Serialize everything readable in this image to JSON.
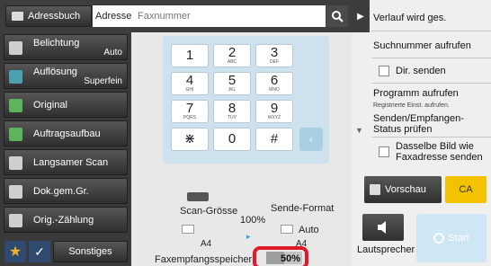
{
  "topbar": {
    "adressbuch_label": "Adressbuch",
    "adresse_label": "Adresse",
    "fax_placeholder": "Faxnummer",
    "search_icon": "search-icon"
  },
  "menu": [
    {
      "label": "Belichtung",
      "value": "Auto",
      "icon": "exposure-icon"
    },
    {
      "label": "Auflösung",
      "value": "Superfein",
      "icon": "resolution-icon"
    },
    {
      "label": "Original",
      "value": "",
      "icon": "original-icon"
    },
    {
      "label": "Auftragsaufbau",
      "value": "",
      "icon": "job-build-icon"
    },
    {
      "label": "Langsamer Scan",
      "value": "",
      "icon": "slow-scan-icon"
    },
    {
      "label": "Dok.gem.Gr.",
      "value": "",
      "icon": "mixed-size-icon"
    },
    {
      "label": "Orig.-Zählung",
      "value": "",
      "icon": "count-icon"
    }
  ],
  "bottom": {
    "star_icon": "★",
    "check_icon": "✓",
    "sonstiges_label": "Sonstiges"
  },
  "keypad": {
    "keys": [
      {
        "k": "1",
        "s": ""
      },
      {
        "k": "2",
        "s": "ABC"
      },
      {
        "k": "3",
        "s": "DEF"
      },
      {
        "k": "4",
        "s": "GHI"
      },
      {
        "k": "5",
        "s": "JKL"
      },
      {
        "k": "6",
        "s": "MNO"
      },
      {
        "k": "7",
        "s": "PQRS"
      },
      {
        "k": "8",
        "s": "TUV"
      },
      {
        "k": "9",
        "s": "WXYZ"
      },
      {
        "k": "⋇",
        "s": ""
      },
      {
        "k": "0",
        "s": ""
      },
      {
        "k": "#",
        "s": ""
      }
    ]
  },
  "scan": {
    "scan_groesse_label": "Scan-Grösse",
    "sende_format_label": "Sende-Format",
    "percent": "100%",
    "auto": "Auto",
    "scan_size": "A4",
    "send_size": "A4"
  },
  "memory": {
    "label": "Faxempfangsspeicher",
    "value": "50%",
    "fill_fraction": 0.5
  },
  "right": {
    "items": [
      "Verlauf wird ges.",
      "Suchnummer aufrufen",
      "Dir. senden",
      "Programm aufrufen",
      "Registrierte Einst. aufrufen.",
      "Senden/Empfangen-Status prüfen",
      "Dasselbe Bild wie Faxadresse senden"
    ],
    "vorschau_label": "Vorschau",
    "ca_label": "CA",
    "lautsprecher_label": "Lautsprecher",
    "start_label": "Start"
  },
  "colors": {
    "accent": "#f3c200",
    "start": "#cfe6f5",
    "highlight": "#e0192b"
  }
}
